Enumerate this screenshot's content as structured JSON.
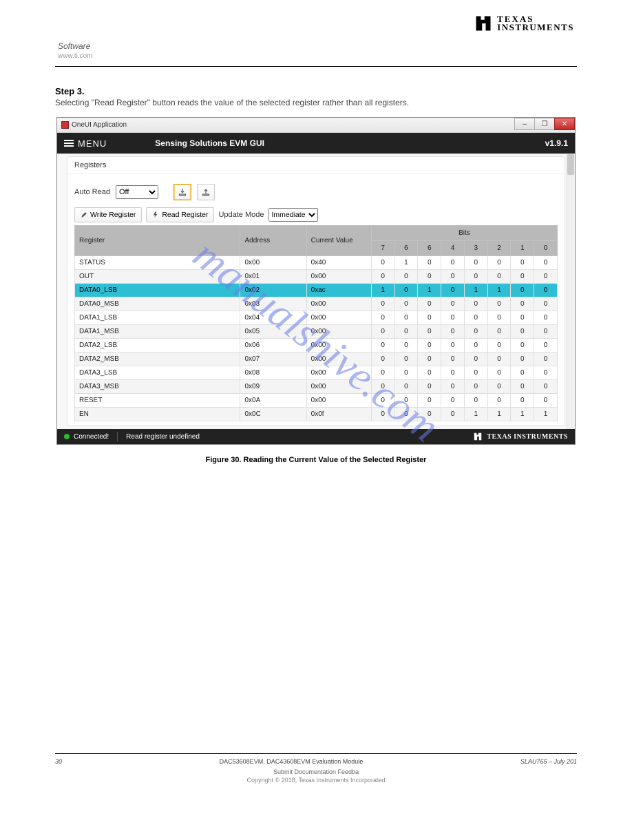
{
  "doc": {
    "header_section": "Software",
    "header_link": "www.ti.com",
    "step_title": "Step 3.",
    "step_text": "Selecting \"Read Register\" button reads the value of the selected register rather than all registers.",
    "figure_caption": "Figure 30. Reading the Current Value of the Selected Register",
    "footer_left": "30",
    "footer_mid": "DAC53608EVM, DAC43608EVM Evaluation Module",
    "footer_right": "SLAU765 – July 201",
    "subfooter": "Submit Documentation Feedba",
    "notice": "Copyright © 2018, Texas Instruments Incorporated"
  },
  "window": {
    "title": "OneUI Application",
    "min": "–",
    "max": "❐",
    "close": "✕"
  },
  "appbar": {
    "menu": "MENU",
    "title": "Sensing Solutions EVM GUI",
    "version": "v1.9.1"
  },
  "panel": {
    "heading": "Registers",
    "autoread_label": "Auto Read",
    "autoread_value": "Off",
    "write_label": "Write Register",
    "read_label": "Read Register",
    "update_mode_label": "Update Mode",
    "update_mode_value": "Immediate"
  },
  "table": {
    "col_register": "Register",
    "col_address": "Address",
    "col_value": "Current Value",
    "col_bits": "Bits",
    "bit_headers": [
      "7",
      "6",
      "6",
      "4",
      "3",
      "2",
      "1",
      "0"
    ],
    "rows": [
      {
        "reg": "STATUS",
        "addr": "0x00",
        "val": "0x40",
        "bits": [
          "0",
          "1",
          "0",
          "0",
          "0",
          "0",
          "0",
          "0"
        ],
        "sel": false
      },
      {
        "reg": "OUT",
        "addr": "0x01",
        "val": "0x00",
        "bits": [
          "0",
          "0",
          "0",
          "0",
          "0",
          "0",
          "0",
          "0"
        ],
        "sel": false
      },
      {
        "reg": "DATA0_LSB",
        "addr": "0x02",
        "val": "0xac",
        "bits": [
          "1",
          "0",
          "1",
          "0",
          "1",
          "1",
          "0",
          "0"
        ],
        "sel": true
      },
      {
        "reg": "DATA0_MSB",
        "addr": "0x03",
        "val": "0x00",
        "bits": [
          "0",
          "0",
          "0",
          "0",
          "0",
          "0",
          "0",
          "0"
        ],
        "sel": false
      },
      {
        "reg": "DATA1_LSB",
        "addr": "0x04",
        "val": "0x00",
        "bits": [
          "0",
          "0",
          "0",
          "0",
          "0",
          "0",
          "0",
          "0"
        ],
        "sel": false
      },
      {
        "reg": "DATA1_MSB",
        "addr": "0x05",
        "val": "0x00",
        "bits": [
          "0",
          "0",
          "0",
          "0",
          "0",
          "0",
          "0",
          "0"
        ],
        "sel": false
      },
      {
        "reg": "DATA2_LSB",
        "addr": "0x06",
        "val": "0x00",
        "bits": [
          "0",
          "0",
          "0",
          "0",
          "0",
          "0",
          "0",
          "0"
        ],
        "sel": false
      },
      {
        "reg": "DATA2_MSB",
        "addr": "0x07",
        "val": "0x00",
        "bits": [
          "0",
          "0",
          "0",
          "0",
          "0",
          "0",
          "0",
          "0"
        ],
        "sel": false
      },
      {
        "reg": "DATA3_LSB",
        "addr": "0x08",
        "val": "0x00",
        "bits": [
          "0",
          "0",
          "0",
          "0",
          "0",
          "0",
          "0",
          "0"
        ],
        "sel": false
      },
      {
        "reg": "DATA3_MSB",
        "addr": "0x09",
        "val": "0x00",
        "bits": [
          "0",
          "0",
          "0",
          "0",
          "0",
          "0",
          "0",
          "0"
        ],
        "sel": false
      },
      {
        "reg": "RESET",
        "addr": "0x0A",
        "val": "0x00",
        "bits": [
          "0",
          "0",
          "0",
          "0",
          "0",
          "0",
          "0",
          "0"
        ],
        "sel": false
      },
      {
        "reg": "EN",
        "addr": "0x0C",
        "val": "0x0f",
        "bits": [
          "0",
          "0",
          "0",
          "0",
          "1",
          "1",
          "1",
          "1"
        ],
        "sel": false
      }
    ]
  },
  "statusbar": {
    "connected": "Connected!",
    "last_action": "Read register undefined",
    "ti_text": "TEXAS INSTRUMENTS"
  },
  "watermark": "manualshive.com"
}
